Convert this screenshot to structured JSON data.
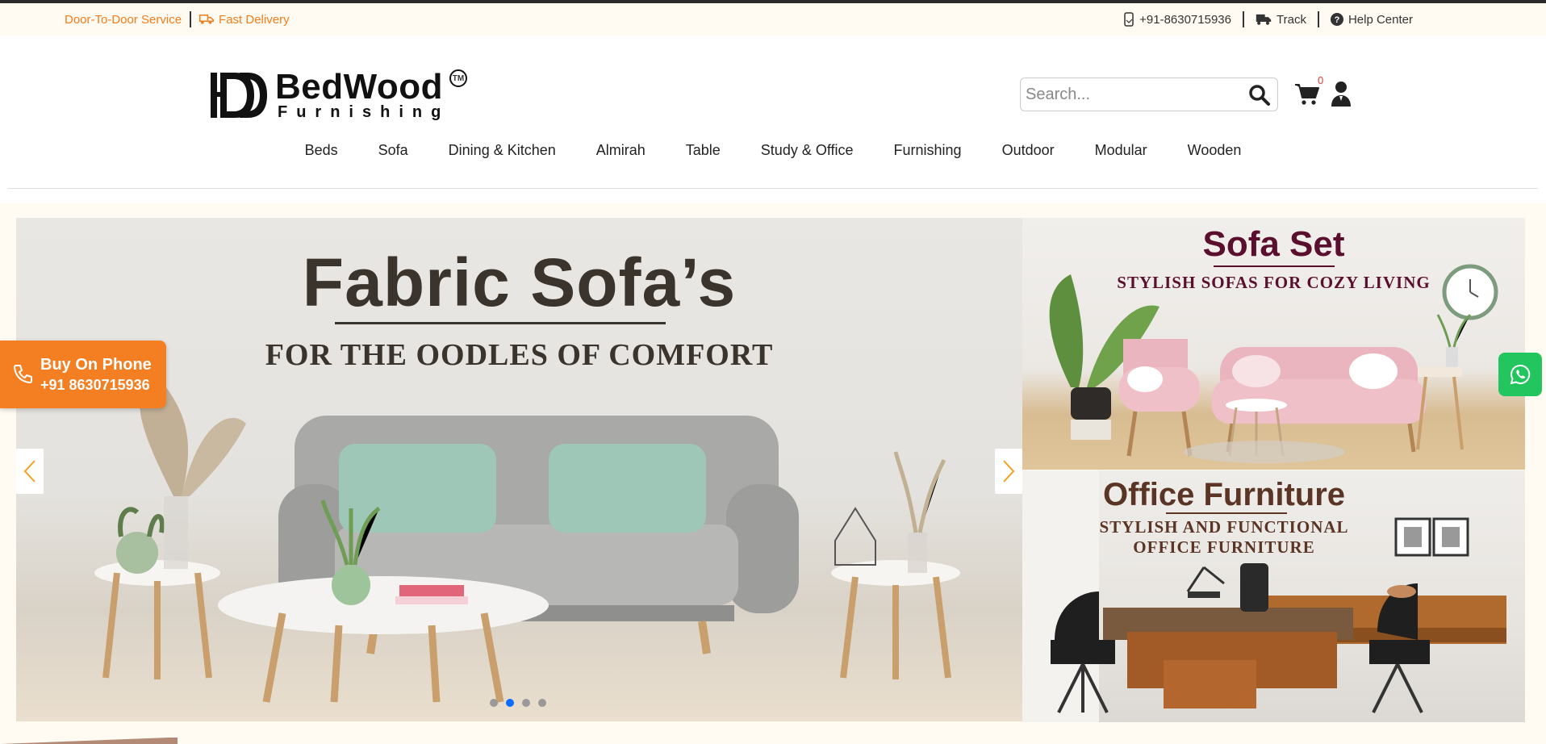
{
  "topbar": {
    "door_to_door": "Door-To-Door Service",
    "fast_delivery": "Fast Delivery",
    "phone": "+91-8630715936",
    "track": "Track",
    "help_center": "Help Center"
  },
  "logo": {
    "monogram": "BD",
    "name": "BedWood",
    "sub": "Furnishing",
    "tm": "TM"
  },
  "search": {
    "placeholder": "Search..."
  },
  "cart": {
    "count": "0"
  },
  "nav": {
    "items": [
      "Beds",
      "Sofa",
      "Dining & Kitchen",
      "Almirah",
      "Table",
      "Study & Office",
      "Furnishing",
      "Outdoor",
      "Modular",
      "Wooden"
    ]
  },
  "hero": {
    "main": {
      "title": "Fabric Sofa’s",
      "subtitle": "FOR THE OODLES OF COMFORT"
    },
    "side1": {
      "title": "Sofa Set",
      "subtitle": "STYLISH SOFAS FOR COZY LIVING"
    },
    "side2": {
      "title": "Office Furniture",
      "subtitle_line1": "STYLISH AND FUNCTIONAL",
      "subtitle_line2": "OFFICE FURNITURE"
    }
  },
  "slider": {
    "slide_count": 4,
    "active_index": 1
  },
  "buy_on_phone": {
    "title": "Buy On Phone",
    "number": "+91 8630715936"
  },
  "colors": {
    "accent_orange": "#f37d1b",
    "whatsapp_green": "#22c55e",
    "active_dot": "#0d6efd",
    "side1_title": "#5a0f2e",
    "side2_title": "#5a3424"
  }
}
